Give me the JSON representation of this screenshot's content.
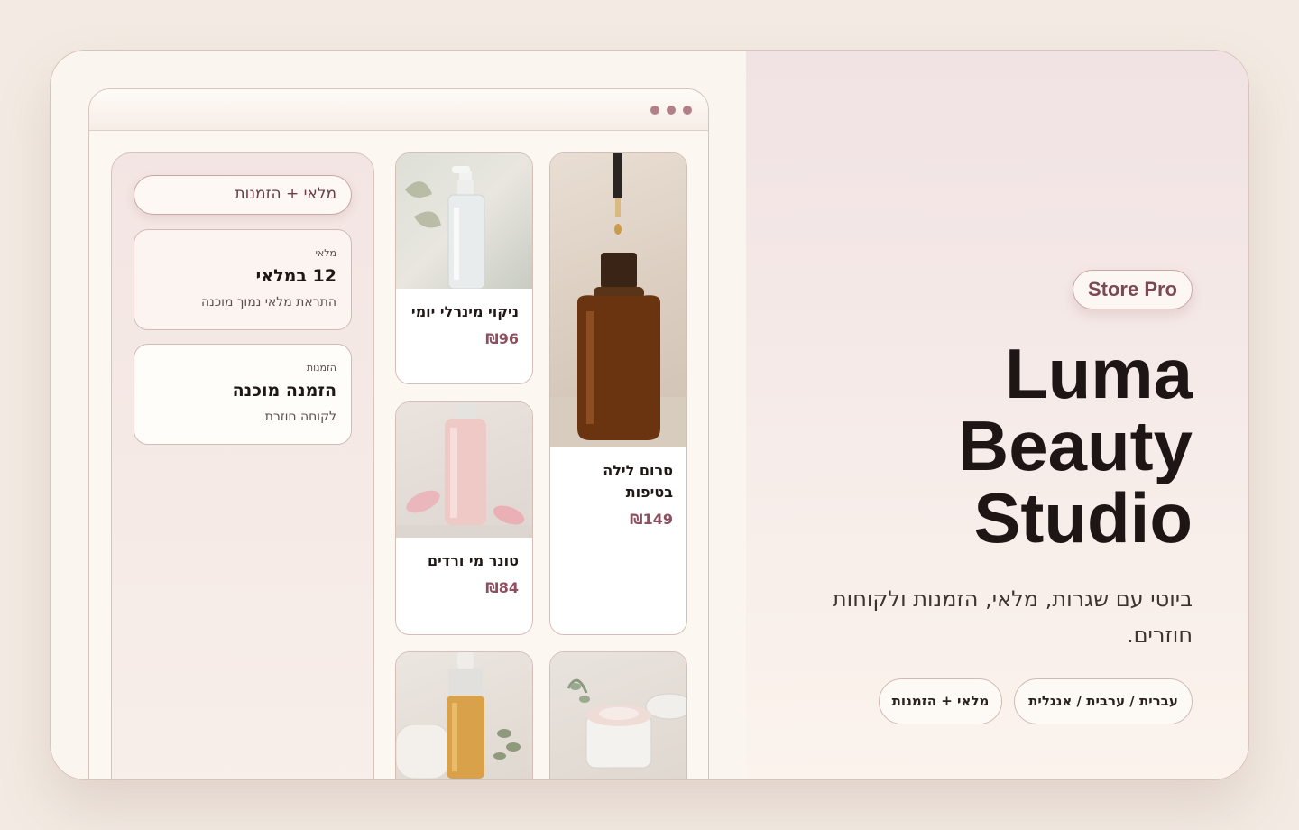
{
  "hero": {
    "badge": "Store Pro",
    "title_lines": [
      "Luma",
      "Beauty",
      "Studio"
    ],
    "subtitle": "ביוטי עם שגרות, מלאי, הזמנות ולקוחות חוזרים.",
    "pills": {
      "languages": "עברית / ערבית / אנגלית",
      "features": "מלאי + הזמנות"
    }
  },
  "sidebar": {
    "button_label": "מלאי + הזמנות",
    "cards": [
      {
        "label": "מלאי",
        "title": "12 במלאי",
        "desc": "התראת מלאי נמוך מוכנה"
      },
      {
        "label": "הזמנות",
        "title": "הזמנה מוכנה",
        "desc": "לקוחה חוזרת"
      }
    ]
  },
  "products": [
    {
      "name": "סרום לילה בטיפות",
      "price": "₪149"
    },
    {
      "name": "ניקוי מינרלי יומי",
      "price": "₪96"
    },
    {
      "name": "טונר מי ורדים",
      "price": "₪84"
    },
    {
      "name": "",
      "price": ""
    },
    {
      "name": "",
      "price": ""
    }
  ],
  "colors": {
    "accent": "#7c4952",
    "price": "#8d5060",
    "border": "#d8c2bc",
    "dots": "#b48088"
  },
  "icons": {
    "window_dots": "more-dots-icon"
  }
}
